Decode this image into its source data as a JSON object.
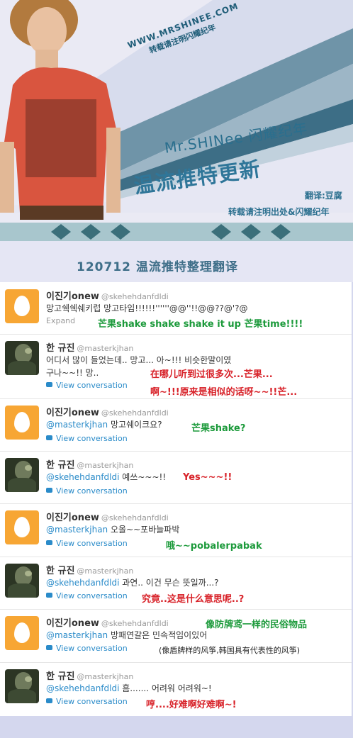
{
  "banner": {
    "site": "WWW.MRSHINEE.COM",
    "site_note": "转载请注明闪耀纪年",
    "title": "Mr.SHINee 闪耀纪年",
    "subtitle": "温流推特更新",
    "translator": "翻译:豆腐",
    "repost_note": "转载请注明出处&闪耀纪年"
  },
  "heading": "120712 温流推特整理翻译",
  "colors": {
    "translation_green": "#1c9a3b",
    "translation_red": "#d8232a",
    "link_blue": "#2a8bc9",
    "egg_orange": "#f7a634"
  },
  "tweets": [
    {
      "name": "이진기onew",
      "handle": "@skehehdanfdldi",
      "avatar": "egg-avatar-icon",
      "text": "망고쉑쉑쉐키럽 망고타임!!!!!!''''''@@''!!@@??@'?@",
      "action": "Expand",
      "translation": "芒果shake shake shake it up 芒果time!!!!"
    },
    {
      "name": "한 규진",
      "handle": "@masterkjhan",
      "avatar": "photo-avatar",
      "text": "어디서 많이 들었는데.. 망고... 아~!!! 비슷한말이였",
      "text2": "구나~~!! 망..",
      "action": "View conversation",
      "translation": "在哪儿听到过很多次...芒果...",
      "translation2": "啊~!!!原来是相似的话呀~~!!芒..."
    },
    {
      "name": "이진기onew",
      "handle": "@skehehdanfdldi",
      "avatar": "egg-avatar-icon",
      "mention": "@masterkjhan",
      "text": " 망고쉐이크요?",
      "action": "View conversation",
      "translation": "芒果shake?"
    },
    {
      "name": "한 규진",
      "handle": "@masterkjhan",
      "avatar": "photo-avatar",
      "mention": "@skehehdanfdldi",
      "text": " 예쓰~~~!!",
      "action": "View conversation",
      "translation": "Yes~~~!!"
    },
    {
      "name": "이진기onew",
      "handle": "@skehehdanfdldi",
      "avatar": "egg-avatar-icon",
      "mention": "@masterkjhan",
      "text": " 오올~~포바늘파박",
      "action": "View conversation",
      "translation": "哦~~pobalerpabak"
    },
    {
      "name": "한 규진",
      "handle": "@masterkjhan",
      "avatar": "photo-avatar",
      "mention": "@skehehdanfdldi",
      "text": " 과연.. 이건 무슨 뜻일까...?",
      "action": "View conversation",
      "translation": "究竟..这是什么意思呢..?"
    },
    {
      "name": "이진기onew",
      "handle": "@skehehdanfdldi",
      "avatar": "egg-avatar-icon",
      "mention": "@masterkjhan",
      "text": " 방패연갈은 민속적임이있어",
      "action": "View conversation",
      "translation": "像防牌鸢一样的民俗物品",
      "note": "(像盾牌样的风筝,韩国具有代表性的风筝)"
    },
    {
      "name": "한 규진",
      "handle": "@masterkjhan",
      "avatar": "photo-avatar",
      "mention": "@skehehdanfdldi",
      "text": " 흠....... 어려워 어려워~!",
      "action": "View conversation",
      "translation": "哼....好难啊好难啊~!"
    }
  ]
}
